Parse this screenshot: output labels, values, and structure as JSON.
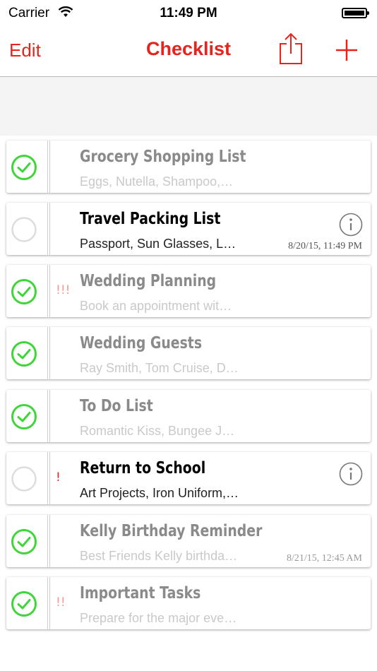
{
  "status_bar": {
    "carrier": "Carrier",
    "time": "11:49 PM"
  },
  "nav": {
    "edit_label": "Edit",
    "title": "Checklist",
    "share_icon": "share-icon",
    "add_icon": "plus-icon"
  },
  "colors": {
    "accent": "#e8231d",
    "check_green": "#3fd63a",
    "unchecked_circle": "#dddddd"
  },
  "lists": [
    {
      "title": "Grocery Shopping List",
      "subtitle": "Eggs, Nutella, Shampoo,…",
      "done": true,
      "priority": "",
      "date": "",
      "info": false
    },
    {
      "title": "Travel Packing List",
      "subtitle": "Passport, Sun Glasses, L…",
      "done": false,
      "priority": "",
      "date": "8/20/15, 11:49 PM",
      "info": true
    },
    {
      "title": "Wedding Planning",
      "subtitle": "Book an appointment wit…",
      "done": true,
      "priority": "!!!",
      "date": "",
      "info": false
    },
    {
      "title": "Wedding Guests",
      "subtitle": "Ray Smith, Tom Cruise, D…",
      "done": true,
      "priority": "",
      "date": "",
      "info": false
    },
    {
      "title": "To Do List",
      "subtitle": "Romantic Kiss, Bungee J…",
      "done": true,
      "priority": "",
      "date": "",
      "info": false
    },
    {
      "title": "Return to School",
      "subtitle": "Art Projects, Iron Uniform,…",
      "done": false,
      "priority": "!",
      "date": "",
      "info": true
    },
    {
      "title": "Kelly Birthday Reminder",
      "subtitle": "Best Friends Kelly birthda…",
      "done": true,
      "priority": "",
      "date": "8/21/15, 12:45 AM",
      "info": false
    },
    {
      "title": "Important Tasks",
      "subtitle": "Prepare for the major eve…",
      "done": true,
      "priority": "!!",
      "date": "",
      "info": false
    }
  ]
}
